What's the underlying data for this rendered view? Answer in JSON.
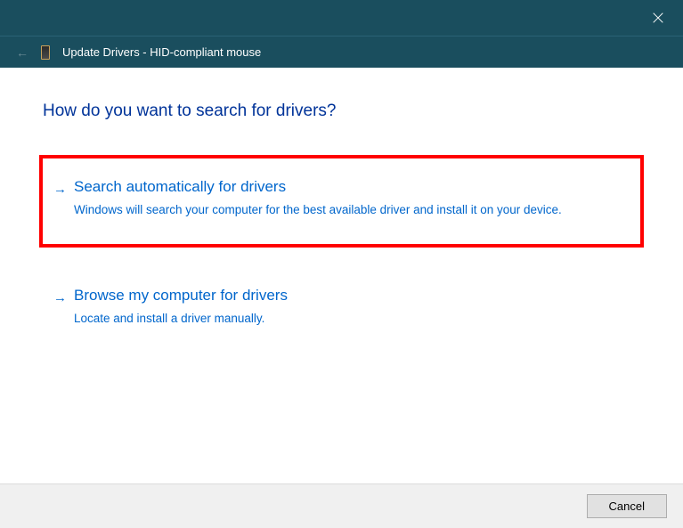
{
  "window": {
    "title": "Update Drivers - HID-compliant mouse"
  },
  "main": {
    "question": "How do you want to search for drivers?"
  },
  "options": [
    {
      "title": "Search automatically for drivers",
      "description": "Windows will search your computer for the best available driver and install it on your device."
    },
    {
      "title": "Browse my computer for drivers",
      "description": "Locate and install a driver manually."
    }
  ],
  "footer": {
    "cancel_label": "Cancel"
  }
}
